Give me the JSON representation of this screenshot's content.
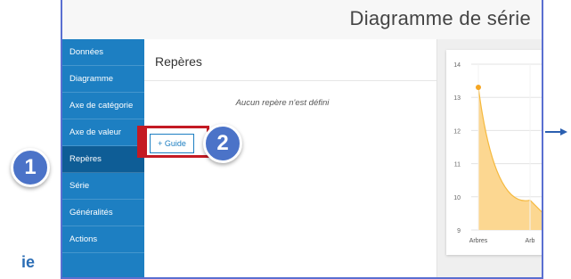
{
  "window": {
    "title": "Diagramme de série"
  },
  "sidebar": {
    "items": [
      {
        "label": "Données"
      },
      {
        "label": "Diagramme"
      },
      {
        "label": "Axe de catégorie"
      },
      {
        "label": "Axe de valeur"
      },
      {
        "label": "Repères",
        "active": true
      },
      {
        "label": "Série"
      },
      {
        "label": "Généralités"
      },
      {
        "label": "Actions"
      }
    ]
  },
  "panel": {
    "title": "Repères",
    "empty_message": "Aucun repère n'est défini",
    "add_guide_label": "+ Guide"
  },
  "callouts": {
    "first": "1",
    "second": "2"
  },
  "left_text": "ie",
  "colors": {
    "accent": "#1d7fc2",
    "callout": "#4b73c8",
    "highlight": "#c41a23",
    "series": "#f5b93e"
  },
  "chart_data": {
    "type": "area",
    "y_ticks": [
      "14",
      "13",
      "12",
      "11",
      "10",
      "9"
    ],
    "ylim": [
      9,
      14
    ],
    "categories": [
      "Arbres",
      "Arb"
    ],
    "values": [
      13.3,
      9.9
    ],
    "xlabel": "",
    "ylabel": ""
  }
}
